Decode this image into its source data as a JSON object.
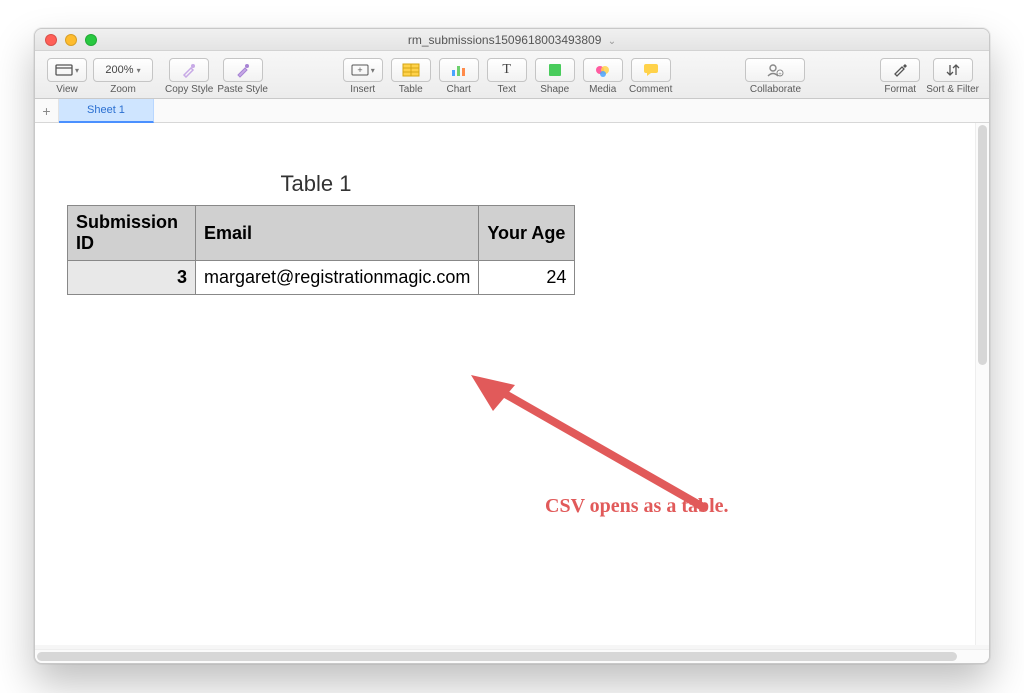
{
  "window": {
    "title": "rm_submissions1509618003493809"
  },
  "toolbar": {
    "view_label": "View",
    "zoom_label": "Zoom",
    "zoom_value": "200%",
    "copy_style_label": "Copy Style",
    "paste_style_label": "Paste Style",
    "insert_label": "Insert",
    "table_label": "Table",
    "chart_label": "Chart",
    "text_label": "Text",
    "shape_label": "Shape",
    "media_label": "Media",
    "comment_label": "Comment",
    "collaborate_label": "Collaborate",
    "format_label": "Format",
    "sort_label": "Sort & Filter"
  },
  "tabs": {
    "sheet1": "Sheet 1"
  },
  "table": {
    "title": "Table 1",
    "headers": {
      "c0": "Submission ID",
      "c1": "Email",
      "c2": "Your Age"
    },
    "rows": [
      {
        "c0": "3",
        "c1": "margaret@registrationmagic.com",
        "c2": "24"
      }
    ]
  },
  "annotation": {
    "text": "CSV opens as a table."
  }
}
